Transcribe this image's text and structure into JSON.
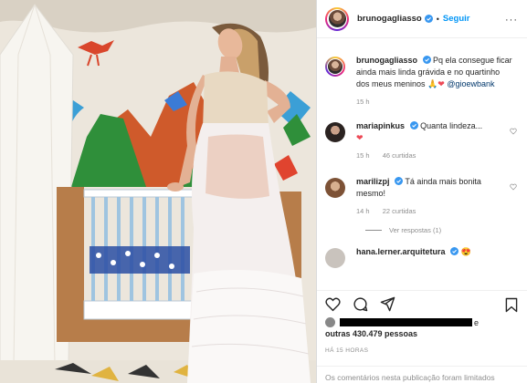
{
  "post": {
    "author": "brunogagliasso",
    "follow_label": "Seguir",
    "dot": "•",
    "more_icon": "···",
    "caption": "Pq ela consegue ficar ainda mais linda grávida e no quartinho dos meus meninos",
    "caption_emojis": "🙏❤",
    "caption_mention": "@gioewbank",
    "caption_time": "15 h"
  },
  "comments": [
    {
      "user": "mariapinkus",
      "text": "Quanta lindeza...",
      "emoji": "❤",
      "time": "15 h",
      "likes": "46 curtidas"
    },
    {
      "user": "marilizpj",
      "text": "Tá ainda mais bonita mesmo!",
      "time": "14 h",
      "likes": "22 curtidas",
      "replies_label": "Ver respostas (1)"
    },
    {
      "user": "hana.lerner.arquitetura",
      "text": "",
      "emoji": "😍"
    }
  ],
  "likes": {
    "suffix": "e",
    "line2": "outras 430.479 pessoas"
  },
  "time_ago": "HÁ 15 HORAS",
  "comments_limited": "Os comentários nesta publicação foram limitados",
  "colors": {
    "link": "#0095f6",
    "mention": "#00376b",
    "muted": "#8e8e8e",
    "heart": "#ed4956"
  }
}
